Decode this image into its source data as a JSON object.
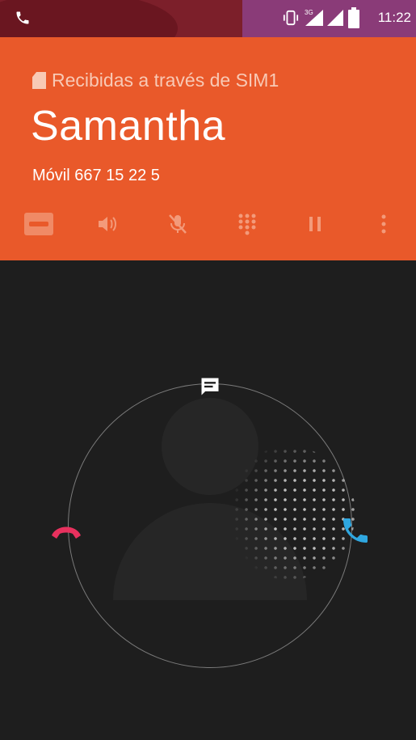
{
  "status_bar": {
    "time": "11:22",
    "icons": [
      "phone-call-icon",
      "vibrate-icon",
      "signal-3g-icon",
      "signal-icon",
      "battery-icon"
    ],
    "network_label": "3G"
  },
  "header": {
    "via": "Recibidas a través de SIM1",
    "caller_name": "Samantha",
    "caller_number": "Móvil 667 15 22 5",
    "background_color": "#e9592a"
  },
  "controls": [
    "dialpad-keyboard-icon",
    "speaker-icon",
    "mute-icon",
    "dialpad-icon",
    "pause-icon",
    "more-icon"
  ],
  "actions": {
    "message_icon": "message-icon",
    "decline_icon": "decline-icon",
    "decline_color": "#e8315e",
    "accept_icon": "accept-icon",
    "accept_color": "#2fa7e0"
  }
}
